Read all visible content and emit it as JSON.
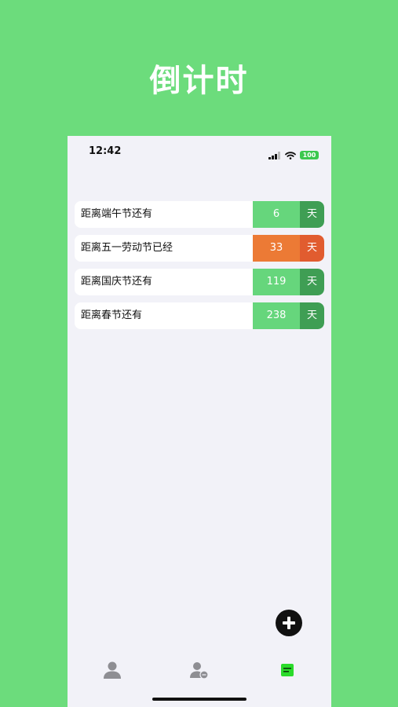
{
  "headline": "倒计时",
  "status_bar": {
    "time": "12:42",
    "battery": "100"
  },
  "countdowns": [
    {
      "label": "距离端午节还有",
      "value": "6",
      "unit": "天",
      "value_color": "#66d67c",
      "unit_color": "#3f9e54"
    },
    {
      "label": "距离五一劳动节已经",
      "value": "33",
      "unit": "天",
      "value_color": "#ec7a35",
      "unit_color": "#e15c2f"
    },
    {
      "label": "距离国庆节还有",
      "value": "119",
      "unit": "天",
      "value_color": "#66d67c",
      "unit_color": "#3f9e54"
    },
    {
      "label": "距离春节还有",
      "value": "238",
      "unit": "天",
      "value_color": "#66d67c",
      "unit_color": "#3f9e54"
    }
  ],
  "icons": {
    "fab": "plus-icon",
    "tabs": [
      "person-icon",
      "person-clock-icon",
      "calendar-icon"
    ]
  },
  "colors": {
    "background": "#6cdc7c",
    "screen": "#f2f2f8",
    "active_tab": "#2bdb2b",
    "inactive_tab": "#8e8e93"
  }
}
